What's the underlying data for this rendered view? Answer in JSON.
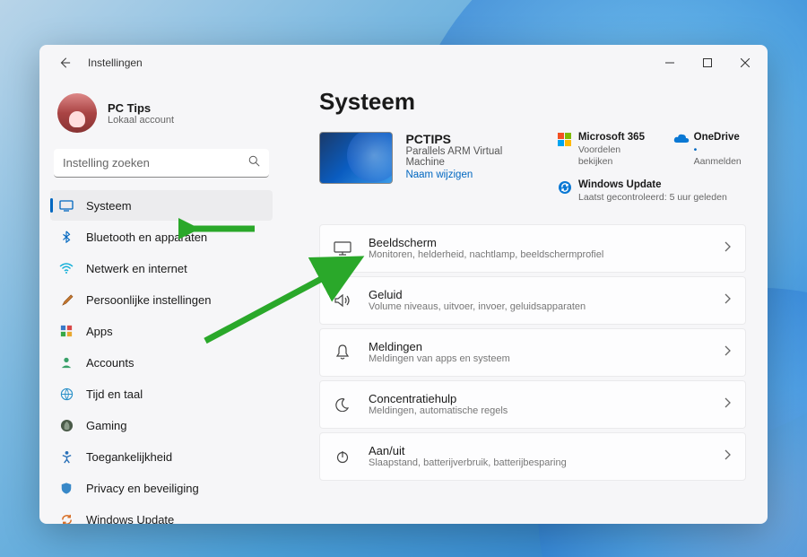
{
  "header": {
    "title": "Instellingen"
  },
  "profile": {
    "name": "PC Tips",
    "sub": "Lokaal account"
  },
  "search": {
    "placeholder": "Instelling zoeken"
  },
  "sidebar": {
    "items": [
      {
        "label": "Systeem",
        "active": true
      },
      {
        "label": "Bluetooth en apparaten"
      },
      {
        "label": "Netwerk en internet"
      },
      {
        "label": "Persoonlijke instellingen"
      },
      {
        "label": "Apps"
      },
      {
        "label": "Accounts"
      },
      {
        "label": "Tijd en taal"
      },
      {
        "label": "Gaming"
      },
      {
        "label": "Toegankelijkheid"
      },
      {
        "label": "Privacy en beveiliging"
      },
      {
        "label": "Windows Update"
      }
    ]
  },
  "page": {
    "title": "Systeem",
    "pc": {
      "name": "PCTIPS",
      "model": "Parallels ARM Virtual Machine",
      "rename": "Naam wijzigen"
    },
    "services": {
      "m365": {
        "title": "Microsoft 365",
        "sub": "Voordelen bekijken"
      },
      "onedrive": {
        "title": "OneDrive",
        "sub": "Aanmelden"
      },
      "update": {
        "title": "Windows Update",
        "sub": "Laatst gecontroleerd: 5 uur geleden"
      }
    },
    "cards": [
      {
        "title": "Beeldscherm",
        "sub": "Monitoren, helderheid, nachtlamp, beeldschermprofiel"
      },
      {
        "title": "Geluid",
        "sub": "Volume niveaus, uitvoer, invoer, geluidsapparaten"
      },
      {
        "title": "Meldingen",
        "sub": "Meldingen van apps en systeem"
      },
      {
        "title": "Concentratiehulp",
        "sub": "Meldingen, automatische regels"
      },
      {
        "title": "Aan/uit",
        "sub": "Slaapstand, batterijverbruik, batterijbesparing"
      }
    ]
  }
}
